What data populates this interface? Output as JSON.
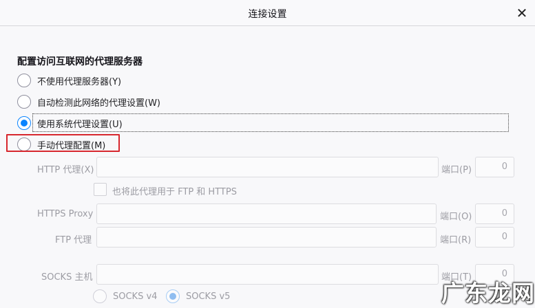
{
  "dialog": {
    "title": "连接设置",
    "close_glyph": "✕"
  },
  "section_title": "配置访问互联网的代理服务器",
  "proxy_options": [
    {
      "label": "不使用代理服务器(Y)",
      "selected": false
    },
    {
      "label": "自动检测此网络的代理设置(W)",
      "selected": false
    },
    {
      "label": "使用系统代理设置(U)",
      "selected": true
    },
    {
      "label": "手动代理配置(M)",
      "selected": false
    }
  ],
  "manual": {
    "http_label": "HTTP 代理(X)",
    "http_value": "",
    "http_port_label": "端口(P)",
    "http_port_value": "0",
    "also_use_label": "也将此代理用于 FTP 和 HTTPS",
    "https_label": "HTTPS Proxy",
    "https_value": "",
    "https_port_label": "端口(O)",
    "https_port_value": "0",
    "ftp_label": "FTP 代理",
    "ftp_value": "",
    "ftp_port_label": "端口(R)",
    "ftp_port_value": "0",
    "socks_label": "SOCKS 主机",
    "socks_value": "",
    "socks_port_label": "端口(T)",
    "socks_port_value": "0",
    "socks_v4_label": "SOCKS v4",
    "socks_v5_label": "SOCKS v5",
    "socks_version_selected": "v5"
  },
  "watermark": "广东龙网",
  "colors": {
    "accent": "#0a84ff",
    "highlight": "#d7262d"
  }
}
